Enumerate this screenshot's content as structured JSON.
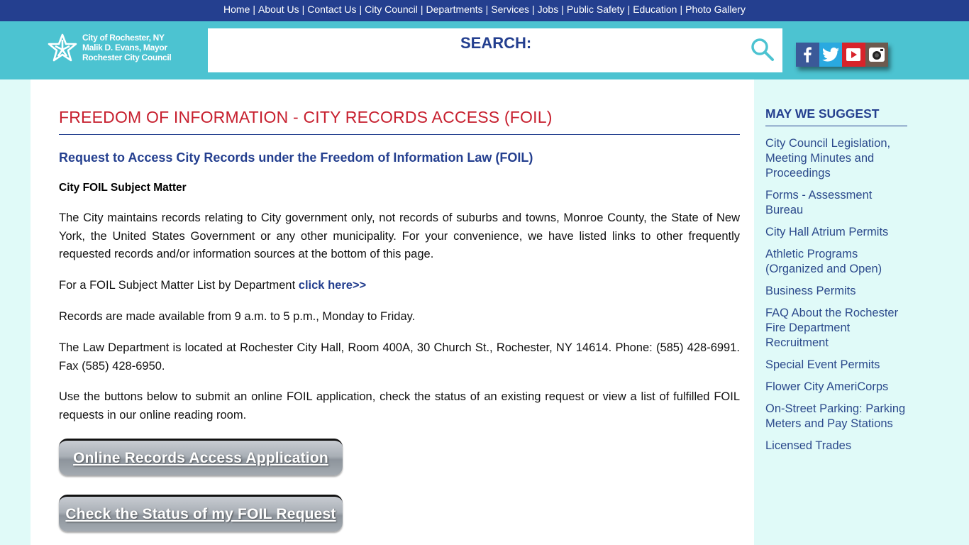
{
  "topnav": {
    "items": [
      "Home",
      "About Us",
      "Contact Us",
      "City Council",
      "Departments",
      "Services",
      "Jobs",
      "Public Safety",
      "Education",
      "Photo Gallery"
    ],
    "separator": "|"
  },
  "header": {
    "logo_lines": [
      "City of Rochester, NY",
      "Malik D. Evans, Mayor",
      "Rochester City Council"
    ],
    "search_label": "SEARCH:",
    "social": [
      "facebook",
      "twitter",
      "youtube",
      "instagram"
    ]
  },
  "colors": {
    "nav_bg": "#243f8f",
    "header_bg": "#4cc3d1",
    "title_red": "#c7202f",
    "accent_blue": "#243f8f",
    "page_bg": "#e0faf8"
  },
  "main": {
    "title": "FREEDOM OF INFORMATION - CITY RECORDS ACCESS (FOIL)",
    "subtitle": "Request to Access City Records under the Freedom of Information Law (FOIL)",
    "subject_heading": "City FOIL Subject Matter",
    "para1": "The City maintains records relating to City government only, not records of suburbs and towns, Monroe County, the State of New York, the United States Government or any other municipality. For your convenience, we have listed links to other frequently requested records and/or information sources at the bottom of this page.",
    "para2_prefix": "For a FOIL Subject Matter List by Department ",
    "para2_link": "click here>>",
    "para3": "Records are made available from 9 a.m. to 5 p.m., Monday to Friday.",
    "para4": "The Law Department is located at Rochester City Hall, Room 400A, 30 Church St., Rochester, NY 14614.  Phone: (585) 428-6991. Fax (585) 428-6950.",
    "para5": "Use the buttons below to submit an online FOIL application, check the status of an existing request or view a list of fulfilled FOIL requests in our online reading room.",
    "button1": "Online Records Access Application",
    "button2": "Check the Status of my FOIL Request"
  },
  "sidebar": {
    "title": "MAY WE SUGGEST",
    "items": [
      "City Council Legislation, Meeting Minutes and Proceedings",
      "Forms - Assessment Bureau",
      "City Hall Atrium Permits",
      "Athletic Programs (Organized and Open)",
      "Business Permits",
      "FAQ About the Rochester Fire Department Recruitment",
      "Special Event Permits",
      "Flower City AmeriCorps",
      "On-Street Parking: Parking Meters and Pay Stations",
      "Licensed Trades"
    ]
  }
}
